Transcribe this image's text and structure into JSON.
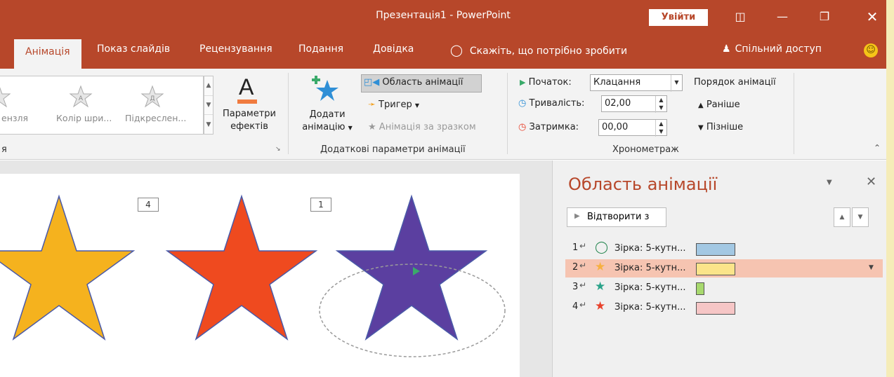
{
  "window": {
    "title": "Презентація1  -  PowerPoint",
    "signin_label": "Увійти",
    "ribbon_display_icon": "ribbon-display-icon",
    "minimize_icon": "minimize-icon",
    "restore_icon": "restore-icon",
    "close_icon": "close-icon"
  },
  "tabs": [
    {
      "label": "Анімація",
      "active": true
    },
    {
      "label": "Показ слайдів"
    },
    {
      "label": "Рецензування"
    },
    {
      "label": "Подання"
    },
    {
      "label": "Довідка"
    }
  ],
  "tell_me": "Скажіть, що потрібно зробити",
  "share": "Спільний доступ",
  "ribbon": {
    "gallery": [
      {
        "label": "ензля"
      },
      {
        "label": "Колір шри..."
      },
      {
        "label": "Підкреслен..."
      }
    ],
    "effect_options": "Параметри\nефектів",
    "group_animation_label": "я",
    "add_animation_line1": "Додати",
    "add_animation_line2": "анімацію",
    "animation_pane": "Область анімації",
    "trigger": "Тригер",
    "animation_painter": "Анімація за зразком",
    "group_advanced_label": "Додаткові параметри анімації",
    "start_label": "Початок:",
    "start_value": "Клацання",
    "duration_label": "Тривалість:",
    "duration_value": "02,00",
    "delay_label": "Затримка:",
    "delay_value": "00,00",
    "timing_group_label": "Хронометраж",
    "reorder_title": "Порядок анімації",
    "move_earlier": "Раніше",
    "move_later": "Пізніше"
  },
  "slide": {
    "badges": [
      "4",
      "1"
    ],
    "stars": [
      {
        "color": "#f5b21e"
      },
      {
        "color": "#ef4a1f"
      },
      {
        "color": "#5b3fa0"
      }
    ]
  },
  "pane": {
    "title": "Область анімації",
    "play_from": "Відтворити з",
    "items": [
      {
        "num": "1",
        "name": "Зірка: 5-кутн...",
        "icon": "spin-icon",
        "icon_color": "#2e8b57",
        "bar_color": "#a3c8e3",
        "bar_width": 56,
        "selected": false
      },
      {
        "num": "2",
        "name": "Зірка: 5-кутн...",
        "icon": "star-icon",
        "icon_color": "#f7b040",
        "bar_color": "#fbe48a",
        "bar_width": 56,
        "selected": true
      },
      {
        "num": "3",
        "name": "Зірка: 5-кутн...",
        "icon": "star-icon",
        "icon_color": "#2aa38a",
        "bar_color": "#a8d96e",
        "bar_width": 12,
        "selected": false
      },
      {
        "num": "4",
        "name": "Зірка: 5-кутн...",
        "icon": "star-icon",
        "icon_color": "#e8412b",
        "bar_color": "#f6c6c6",
        "bar_width": 56,
        "selected": false
      }
    ]
  }
}
